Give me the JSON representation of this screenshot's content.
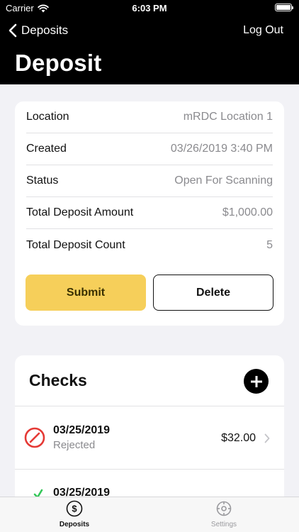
{
  "status_bar": {
    "carrier": "Carrier",
    "time": "6:03 PM"
  },
  "nav": {
    "back_label": "Deposits",
    "right_label": "Log Out",
    "title": "Deposit"
  },
  "details": {
    "rows": [
      {
        "label": "Location",
        "value": "mRDC Location 1"
      },
      {
        "label": "Created",
        "value": "03/26/2019 3:40 PM"
      },
      {
        "label": "Status",
        "value": "Open For Scanning"
      },
      {
        "label": "Total Deposit Amount",
        "value": "$1,000.00"
      },
      {
        "label": "Total Deposit Count",
        "value": "5"
      }
    ],
    "submit_label": "Submit",
    "delete_label": "Delete"
  },
  "checks": {
    "title": "Checks",
    "items": [
      {
        "date": "03/25/2019",
        "status": "Rejected",
        "amount": "$32.00",
        "status_color": "#e53935"
      },
      {
        "date": "03/25/2019",
        "status": "",
        "amount": "",
        "status_color": "#34c759"
      }
    ]
  },
  "tabbar": {
    "tabs": [
      {
        "label": "Deposits",
        "icon": "dollar-circle-icon",
        "active": true
      },
      {
        "label": "Settings",
        "icon": "gear-icon",
        "active": false
      }
    ]
  },
  "colors": {
    "accent_yellow": "#f6cf5a",
    "header_black": "#000000",
    "reject_red": "#e53935",
    "success_green": "#34c759"
  }
}
